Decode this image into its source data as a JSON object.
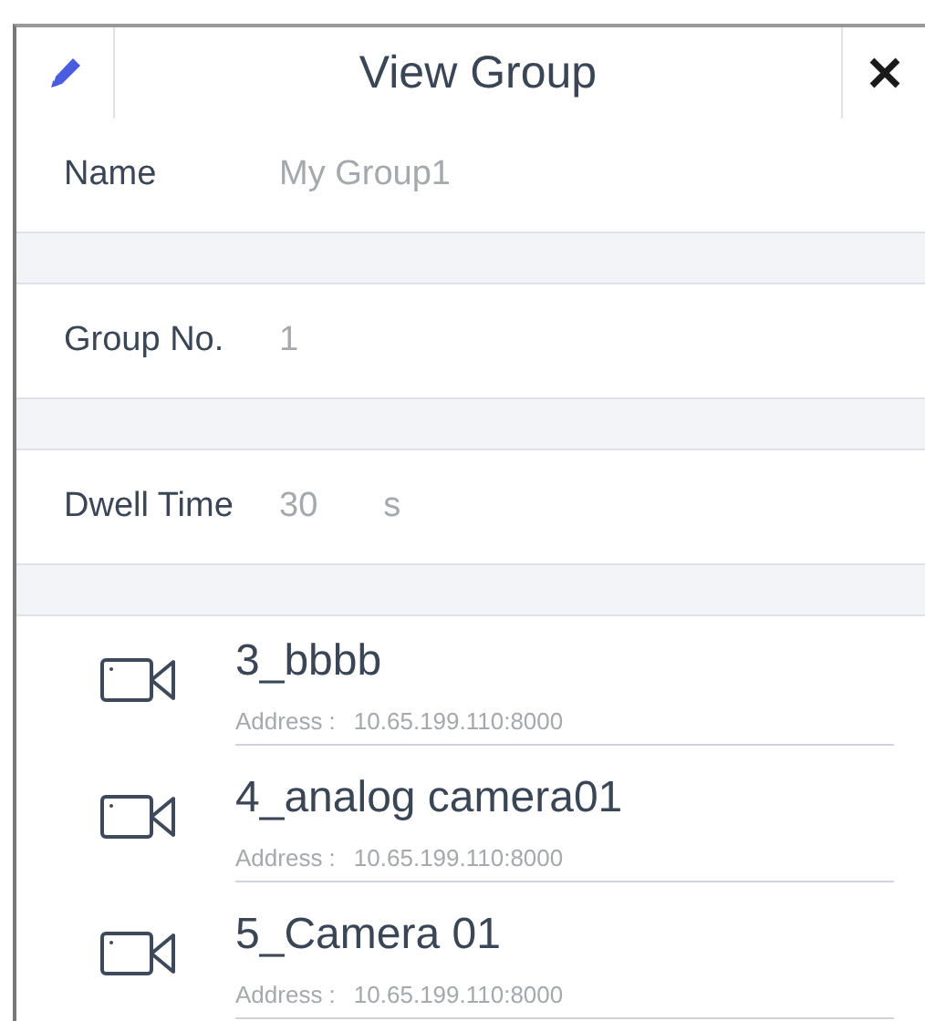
{
  "header": {
    "title": "View Group"
  },
  "fields": [
    {
      "label": "Name",
      "value": "My Group1"
    },
    {
      "label": "Group No.",
      "value": "1"
    },
    {
      "label": "Dwell Time",
      "value": "30",
      "unit": "s"
    }
  ],
  "devices": [
    {
      "name": "3_bbbb",
      "address_label": "Address :",
      "address": "10.65.199.110:8000"
    },
    {
      "name": "4_analog camera01",
      "address_label": "Address :",
      "address": "10.65.199.110:8000"
    },
    {
      "name": "5_Camera 01",
      "address_label": "Address :",
      "address": "10.65.199.110:8000"
    }
  ]
}
